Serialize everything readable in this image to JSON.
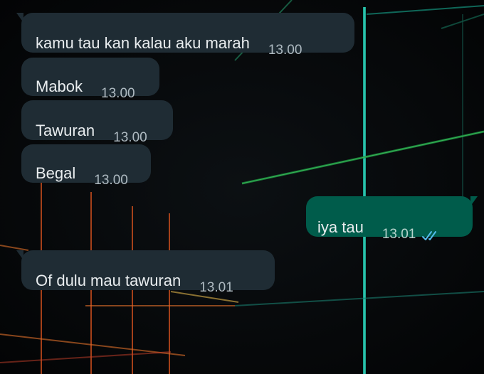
{
  "colors": {
    "incoming_bubble": "#1f2c34",
    "outgoing_bubble": "#005c4b",
    "read_ticks": "#53bdeb"
  },
  "messages": [
    {
      "direction": "in",
      "text": "kamu tau kan kalau aku marah",
      "time": "13.00"
    },
    {
      "direction": "in",
      "text": "Mabok",
      "time": "13.00"
    },
    {
      "direction": "in",
      "text": "Tawuran",
      "time": "13.00"
    },
    {
      "direction": "in",
      "text": "Begal",
      "time": "13.00"
    },
    {
      "direction": "out",
      "text": "iya tau",
      "time": "13.01",
      "status_icon": "double-check-read-icon"
    },
    {
      "direction": "in",
      "text": "Of dulu mau tawuran",
      "time": "13.01"
    }
  ]
}
